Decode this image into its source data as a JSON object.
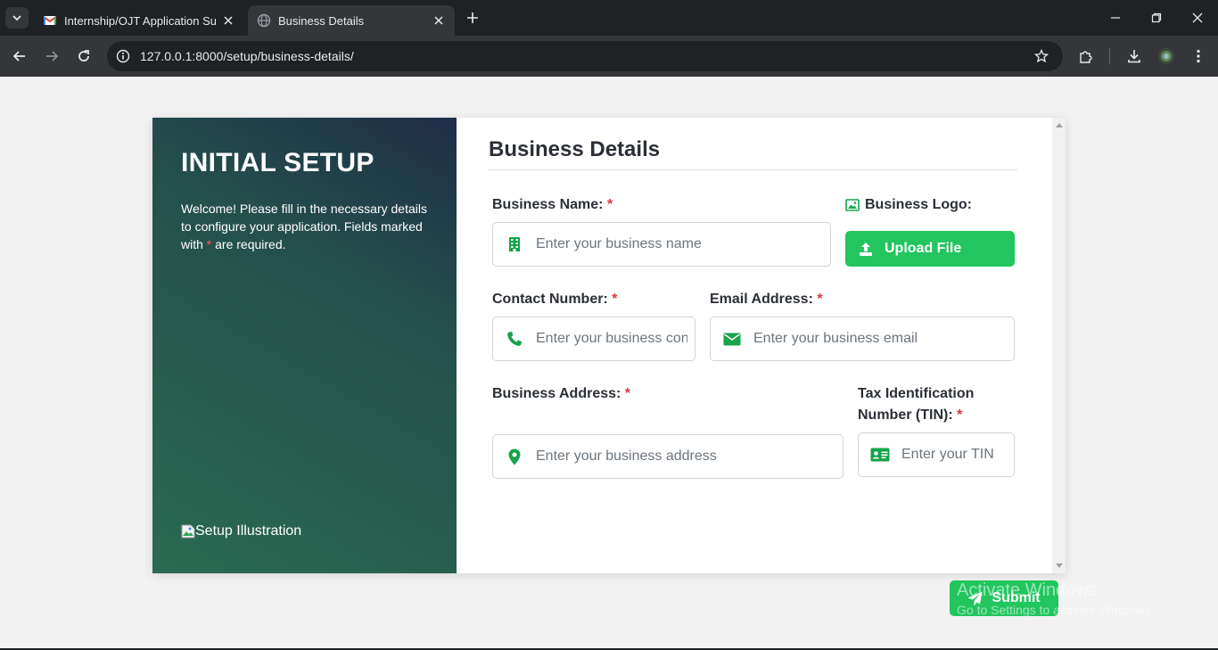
{
  "browser": {
    "tabs": [
      {
        "title": "Internship/OJT Application Sub",
        "active": false,
        "icon": "gmail-icon"
      },
      {
        "title": "Business Details",
        "active": true,
        "icon": "globe-icon"
      }
    ],
    "url": "127.0.0.1:8000/setup/business-details/"
  },
  "sidebar": {
    "heading": "INITIAL SETUP",
    "welcome_pre": "Welcome! Please fill in the necessary details to configure your application. Fields marked with",
    "required_mark": "*",
    "welcome_post": "are required.",
    "illustration_alt": "Setup Illustration"
  },
  "form": {
    "title": "Business Details",
    "required_mark": "*",
    "business_name": {
      "label": "Business Name:",
      "placeholder": "Enter your business name"
    },
    "business_logo": {
      "label": "Business Logo:",
      "button": "Upload File"
    },
    "contact_number": {
      "label": "Contact Number:",
      "placeholder": "Enter your business contact number"
    },
    "email": {
      "label": "Email Address:",
      "placeholder": "Enter your business email"
    },
    "address": {
      "label": "Business Address:",
      "placeholder": "Enter your business address"
    },
    "tin": {
      "label_line1": "Tax Identification",
      "label_line2": "Number (TIN):",
      "placeholder": "Enter your TIN"
    },
    "submit": "Submit"
  },
  "watermark": {
    "line1": "Activate Windows",
    "line2": "Go to Settings to activate Windows."
  },
  "colors": {
    "accent_green": "#22c55e",
    "icon_green": "#16a34a",
    "required_red": "#dc3545"
  }
}
